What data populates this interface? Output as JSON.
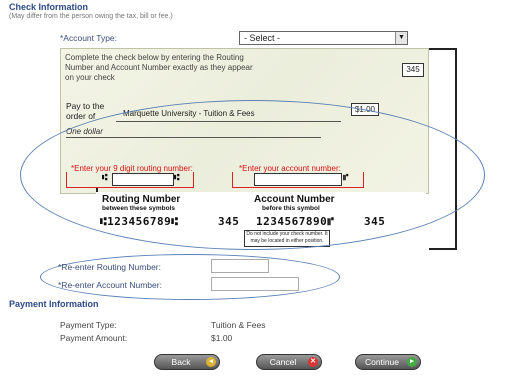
{
  "check_info": {
    "title": "Check Information",
    "note": "(May differ from the person owing the tax, bill or fee.)",
    "account_type_label": "*Account Type:",
    "account_type_value": "- Select -"
  },
  "check": {
    "instruction": "Complete the check below by entering the Routing Number and Account Number exactly as they appear on your check",
    "check_number": "345",
    "pay_to_label": "Pay to the order of",
    "payee": "Marquette University - Tuition & Fees",
    "amount": "$1.00",
    "amount_words": "One dollar",
    "routing_prompt": "*Enter your 9 digit routing number:",
    "account_prompt": "*Enter your account number:"
  },
  "micr": {
    "routing_heading": "Routing Number",
    "routing_sub": "between these symbols",
    "account_heading": "Account Number",
    "account_sub": "before this symbol",
    "routing_digits": "⑆123456789⑆",
    "check_digits": "345",
    "account_digits": "1234567890⑈",
    "check_digits_2": "345",
    "note": "Do not include your check number. It may be located in either position."
  },
  "reenter": {
    "routing_label": "*Re-enter Routing Number:",
    "account_label": "*Re-enter Account Number:"
  },
  "payment": {
    "title": "Payment Information",
    "type_label": "Payment Type:",
    "type_value": "Tuition & Fees",
    "amount_label": "Payment Amount:",
    "amount_value": "$1.00"
  },
  "buttons": {
    "back": "Back",
    "cancel": "Cancel",
    "continue": "Continue"
  },
  "colors": {
    "section_title": "#2d4a8a",
    "required_marker": "#cc0000",
    "highlight_ellipse": "#5b82b6",
    "back_icon": "#d9b233",
    "cancel_icon": "#d93333",
    "continue_icon": "#44aa44"
  }
}
